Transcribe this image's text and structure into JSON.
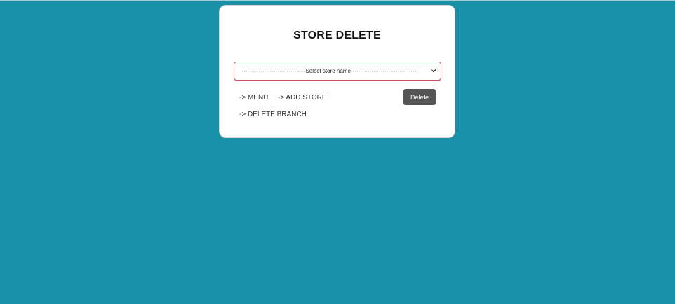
{
  "colors": {
    "background": "#1890a8",
    "card": "#ffffff",
    "button": "#555555",
    "select_border": "#c0505a"
  },
  "page": {
    "title": "STORE DELETE"
  },
  "store_select": {
    "selected": "----------------------------------Select store name-----------------------------------",
    "icon": "chevron-down-icon"
  },
  "links": {
    "menu": "-> MENU",
    "add_store": "-> ADD STORE",
    "delete_branch": "-> DELETE BRANCH"
  },
  "actions": {
    "delete_label": "Delete"
  }
}
